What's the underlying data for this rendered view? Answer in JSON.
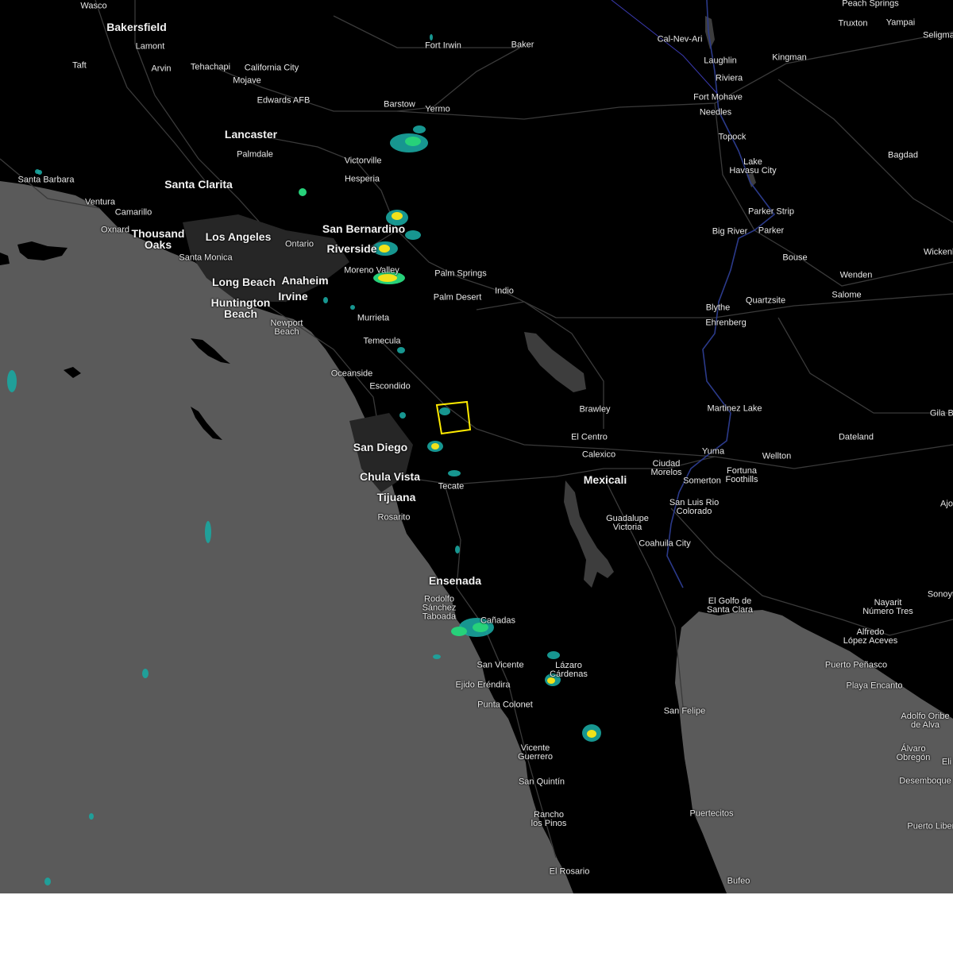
{
  "colors": {
    "land": "#000000",
    "ocean": "#5a5a5a",
    "roads": "#3a3a3a",
    "river": "#2b3a8a",
    "radar_light": "#1aa6a0",
    "radar_med": "#27d17a",
    "radar_heavy": "#f2e21a",
    "warning_box": "#ffeb00"
  },
  "places": [
    {
      "name": "Wasco"
    },
    {
      "name": "Bakersfield"
    },
    {
      "name": "Lamont"
    },
    {
      "name": "Arvin"
    },
    {
      "name": "Taft"
    },
    {
      "name": "Tehachapi"
    },
    {
      "name": "California City"
    },
    {
      "name": "Mojave"
    },
    {
      "name": "Edwards AFB"
    },
    {
      "name": "Lancaster"
    },
    {
      "name": "Palmdale"
    },
    {
      "name": "Santa Clarita"
    },
    {
      "name": "Santa Barbara"
    },
    {
      "name": "Ventura"
    },
    {
      "name": "Camarillo"
    },
    {
      "name": "Oxnard"
    },
    {
      "name": "Thousand Oaks"
    },
    {
      "name": "Los Angeles"
    },
    {
      "name": "Santa Monica"
    },
    {
      "name": "Ontario"
    },
    {
      "name": "Long Beach"
    },
    {
      "name": "Anaheim"
    },
    {
      "name": "Irvine"
    },
    {
      "name": "Huntington Beach"
    },
    {
      "name": "Newport Beach"
    },
    {
      "name": "Fort Irwin"
    },
    {
      "name": "Baker"
    },
    {
      "name": "Barstow"
    },
    {
      "name": "Yermo"
    },
    {
      "name": "Victorville"
    },
    {
      "name": "Hesperia"
    },
    {
      "name": "San Bernardino"
    },
    {
      "name": "Riverside"
    },
    {
      "name": "Moreno Valley"
    },
    {
      "name": "Palm Springs"
    },
    {
      "name": "Palm Desert"
    },
    {
      "name": "Indio"
    },
    {
      "name": "Murrieta"
    },
    {
      "name": "Temecula"
    },
    {
      "name": "Oceanside"
    },
    {
      "name": "Escondido"
    },
    {
      "name": "San Diego"
    },
    {
      "name": "Chula Vista"
    },
    {
      "name": "Tijuana"
    },
    {
      "name": "Tecate"
    },
    {
      "name": "Rosarito"
    },
    {
      "name": "Ensenada"
    },
    {
      "name": "Rodolfo Sánchez Taboada"
    },
    {
      "name": "Cañadas"
    },
    {
      "name": "San Vicente"
    },
    {
      "name": "Ejido Eréndira"
    },
    {
      "name": "Lázaro Cárdenas"
    },
    {
      "name": "Punta Colonet"
    },
    {
      "name": "Vicente Guerrero"
    },
    {
      "name": "San Quintín"
    },
    {
      "name": "Rancho los Pinos"
    },
    {
      "name": "El Rosario"
    },
    {
      "name": "San Felipe"
    },
    {
      "name": "Puertecitos"
    },
    {
      "name": "Bufeo"
    },
    {
      "name": "Brawley"
    },
    {
      "name": "El Centro"
    },
    {
      "name": "Calexico"
    },
    {
      "name": "Mexicali"
    },
    {
      "name": "Ciudad Morelos"
    },
    {
      "name": "Guadalupe Victoria"
    },
    {
      "name": "Coahuila City"
    },
    {
      "name": "San Luis Rio Colorado"
    },
    {
      "name": "Somerton"
    },
    {
      "name": "Yuma"
    },
    {
      "name": "Fortuna Foothills"
    },
    {
      "name": "Wellton"
    },
    {
      "name": "Dateland"
    },
    {
      "name": "Martinez Lake"
    },
    {
      "name": "Blythe"
    },
    {
      "name": "Ehrenberg"
    },
    {
      "name": "Quartzsite"
    },
    {
      "name": "Bouse"
    },
    {
      "name": "Wenden"
    },
    {
      "name": "Salome"
    },
    {
      "name": "Parker Strip"
    },
    {
      "name": "Parker"
    },
    {
      "name": "Big River"
    },
    {
      "name": "Lake Havasu City"
    },
    {
      "name": "Topock"
    },
    {
      "name": "Needles"
    },
    {
      "name": "Fort Mohave"
    },
    {
      "name": "Riviera"
    },
    {
      "name": "Laughlin"
    },
    {
      "name": "Cal-Nev-Ari"
    },
    {
      "name": "Kingman"
    },
    {
      "name": "Peach Springs"
    },
    {
      "name": "Truxton"
    },
    {
      "name": "Yampai"
    },
    {
      "name": "Seligman"
    },
    {
      "name": "Bagdad"
    },
    {
      "name": "El Golfo de Santa Clara"
    },
    {
      "name": "Nayarit Número Tres"
    },
    {
      "name": "Alfredo López Aceves"
    },
    {
      "name": "Puerto Peñasco"
    },
    {
      "name": "Playa Encanto"
    },
    {
      "name": "Adolfo Oribe de Alva"
    },
    {
      "name": "Álvaro Obregón"
    },
    {
      "name": "Desemboque"
    },
    {
      "name": "Puerto Libertad"
    },
    {
      "name": "Sonoyta"
    },
    {
      "name": "Ajo"
    },
    {
      "name": "Wickenburg"
    },
    {
      "name": "Gila Bend"
    },
    {
      "name": "Eli"
    }
  ]
}
